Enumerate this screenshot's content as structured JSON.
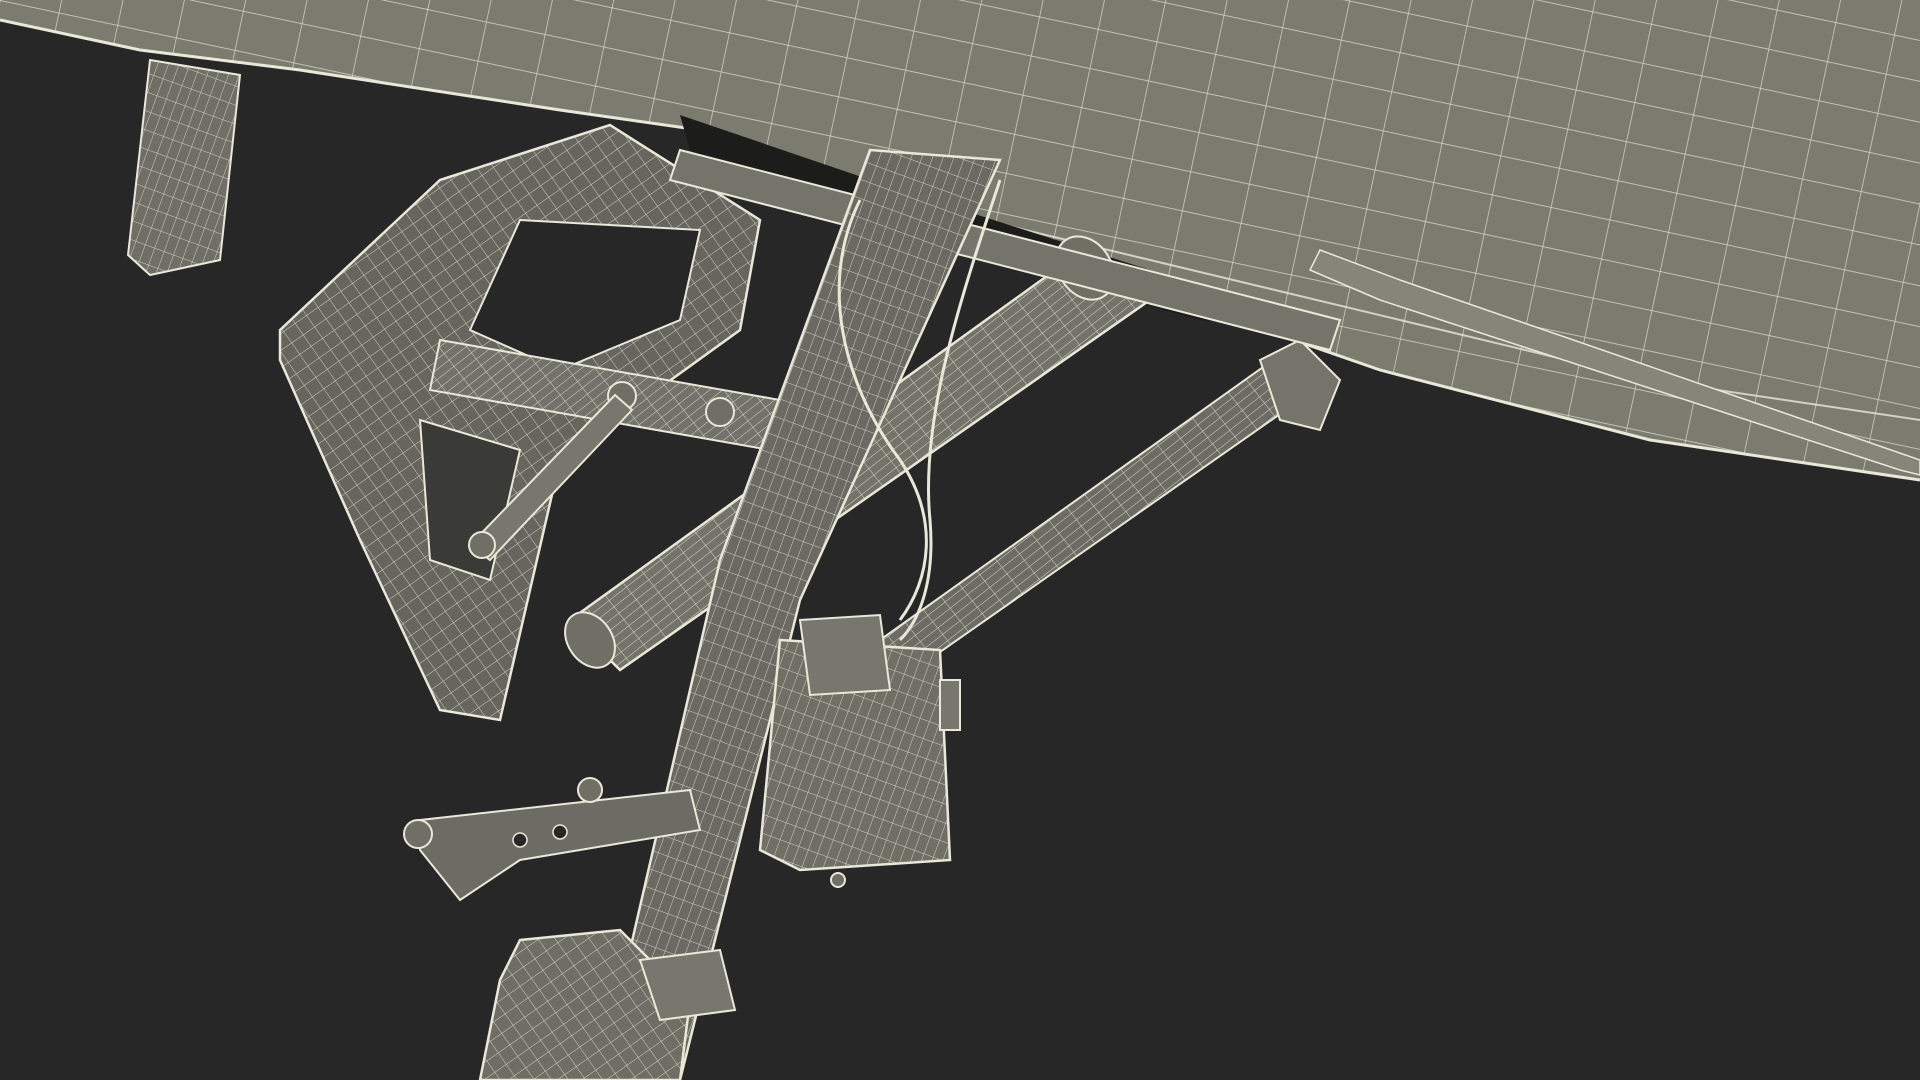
{
  "scene": {
    "description_visible_text": "",
    "colors": {
      "background": "#272727",
      "hull_fill": "#7b7b70",
      "hull_fill_dark": "#6e6e64",
      "part_fill": "#6f6f66",
      "part_fill_dark": "#55554e",
      "shadow_fill": "#1c1c1a",
      "wire": "#e8e8d8",
      "wire_dim": "#c8c8b8"
    }
  }
}
